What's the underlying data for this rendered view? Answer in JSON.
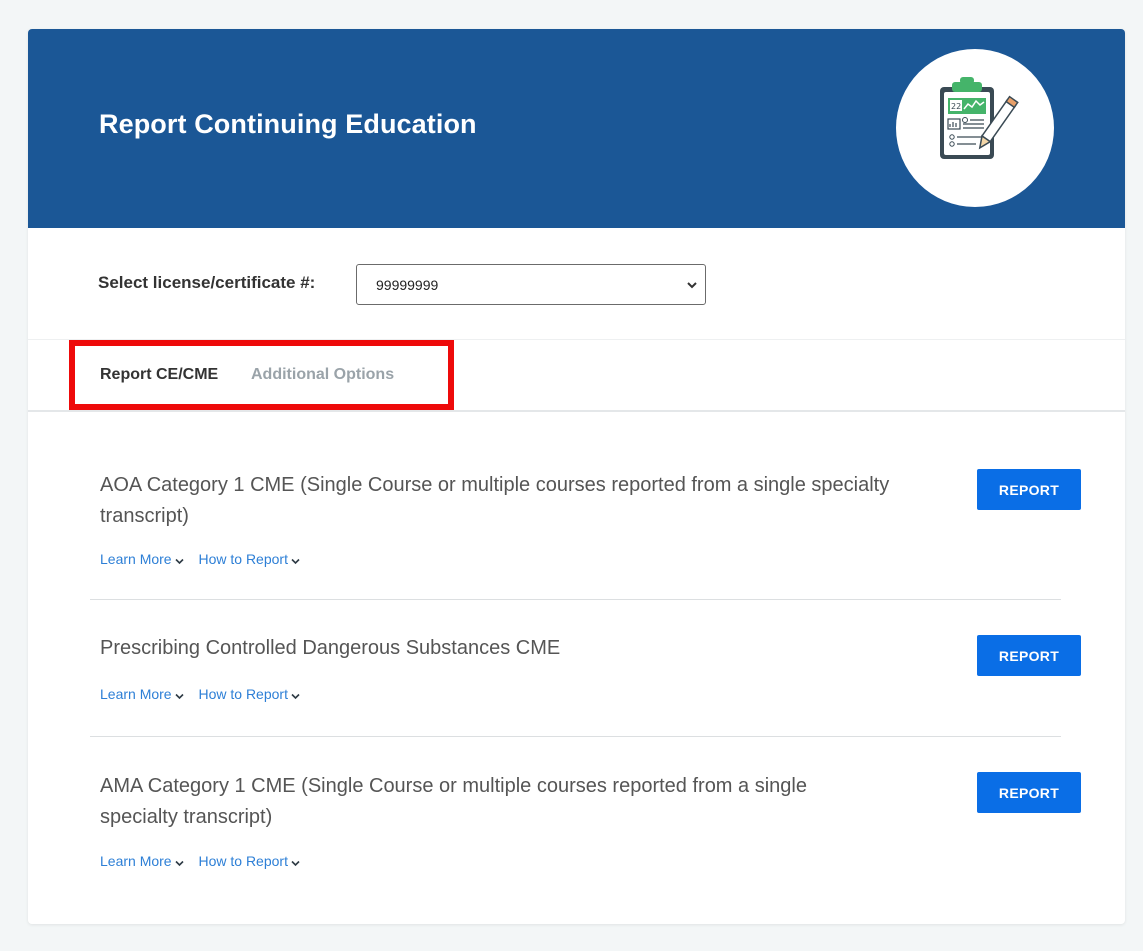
{
  "header": {
    "title": "Report Continuing Education",
    "banner_color": "#1b5796",
    "clipboard_icon": "clipboard-report-icon",
    "clipboard_chart_number": "22"
  },
  "license": {
    "label": "Select license/certificate #:",
    "selected_value": "99999999"
  },
  "tabs": [
    {
      "label": "Report CE/CME",
      "active": true
    },
    {
      "label": "Additional Options",
      "active": false
    }
  ],
  "items": [
    {
      "title": "AOA Category 1 CME (Single Course or multiple courses reported from a single specialty transcript)",
      "learn_more": "Learn More",
      "how_to_report": "How to Report",
      "button_label": "REPORT"
    },
    {
      "title": "Prescribing Controlled Dangerous Substances CME",
      "learn_more": "Learn More",
      "how_to_report": "How to Report",
      "button_label": "REPORT"
    },
    {
      "title": "AMA Category 1 CME (Single Course or multiple courses reported from a single specialty transcript)",
      "learn_more": "Learn More",
      "how_to_report": "How to Report",
      "button_label": "REPORT"
    }
  ],
  "colors": {
    "accent": "#0a6ee6",
    "link": "#2d7fd6",
    "highlight": "#ee0a0a"
  }
}
